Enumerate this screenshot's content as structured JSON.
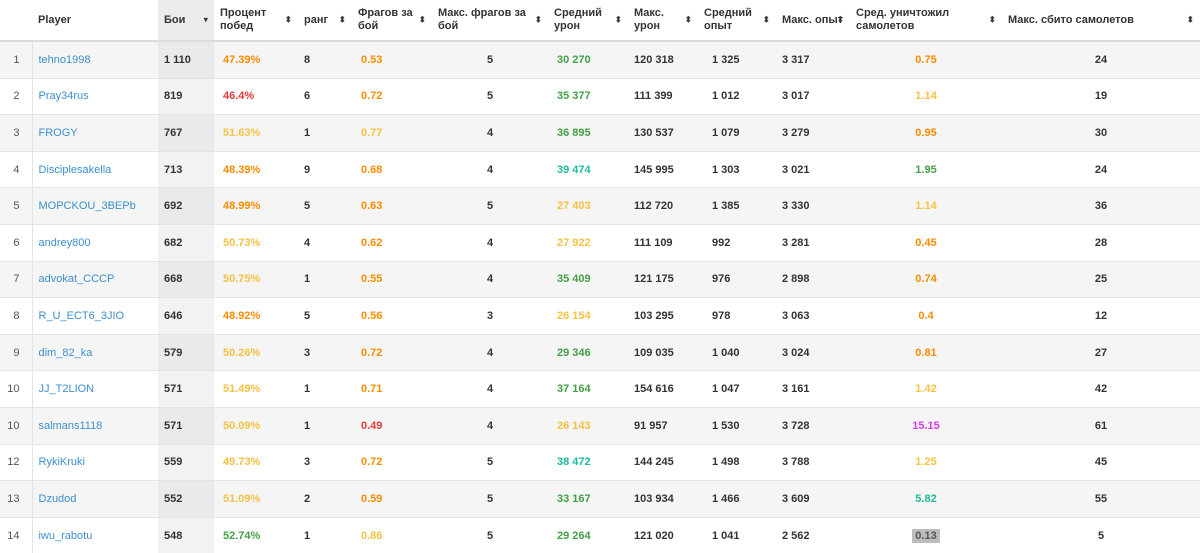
{
  "colors": {
    "orange": "#fb8c00",
    "red": "#e53935",
    "yellow": "#f5c242",
    "green": "#43a047",
    "teal": "#1abc9c",
    "magenta": "#d63df0",
    "dark": "#333333",
    "link": "#3d8fcf"
  },
  "headers": [
    {
      "key": "num",
      "label": "",
      "sort": ""
    },
    {
      "key": "player",
      "label": "Player",
      "sort": ""
    },
    {
      "key": "battles",
      "label": "Бои",
      "sort": "▾"
    },
    {
      "key": "winrate",
      "label": "Процент побед",
      "sort": "⬍"
    },
    {
      "key": "rank",
      "label": "ранг",
      "sort": "⬍"
    },
    {
      "key": "frags",
      "label": "Фрагов за бой",
      "sort": "⬍"
    },
    {
      "key": "maxfrags",
      "label": "Макс. фрагов за бой",
      "sort": "⬍"
    },
    {
      "key": "avgdmg",
      "label": "Средний урон",
      "sort": "⬍"
    },
    {
      "key": "maxdmg",
      "label": "Макс. урон",
      "sort": "⬍"
    },
    {
      "key": "avgxp",
      "label": "Средний опыт",
      "sort": "⬍"
    },
    {
      "key": "maxxp",
      "label": "Макс. опыт",
      "sort": "⬍"
    },
    {
      "key": "avgplanes",
      "label": "Сред. уничтожил самолетов",
      "sort": "⬍"
    },
    {
      "key": "maxplanes",
      "label": "Макс. сбито самолетов",
      "sort": "⬍"
    }
  ],
  "rows": [
    {
      "num": "1",
      "player": "tehno1998",
      "battles": "1 110",
      "winrate": "47.39%",
      "winrate_c": "orange",
      "rank": "8",
      "frags": "0.53",
      "frags_c": "orange",
      "maxfrags": "5",
      "avgdmg": "30 270",
      "avgdmg_c": "green",
      "maxdmg": "120 318",
      "avgxp": "1 325",
      "maxxp": "3 317",
      "avgplanes": "0.75",
      "avgplanes_c": "orange",
      "maxplanes": "24"
    },
    {
      "num": "2",
      "player": "Pray34rus",
      "battles": "819",
      "winrate": "46.4%",
      "winrate_c": "red",
      "rank": "6",
      "frags": "0.72",
      "frags_c": "orange",
      "maxfrags": "5",
      "avgdmg": "35 377",
      "avgdmg_c": "green",
      "maxdmg": "111 399",
      "avgxp": "1 012",
      "maxxp": "3 017",
      "avgplanes": "1.14",
      "avgplanes_c": "yellow",
      "maxplanes": "19"
    },
    {
      "num": "3",
      "player": "FROGY",
      "battles": "767",
      "winrate": "51.63%",
      "winrate_c": "yellow",
      "rank": "1",
      "frags": "0.77",
      "frags_c": "yellow",
      "maxfrags": "4",
      "avgdmg": "36 895",
      "avgdmg_c": "green",
      "maxdmg": "130 537",
      "avgxp": "1 079",
      "maxxp": "3 279",
      "avgplanes": "0.95",
      "avgplanes_c": "orange",
      "maxplanes": "30"
    },
    {
      "num": "4",
      "player": "Disciplesakella",
      "battles": "713",
      "winrate": "48.39%",
      "winrate_c": "orange",
      "rank": "9",
      "frags": "0.68",
      "frags_c": "orange",
      "maxfrags": "4",
      "avgdmg": "39 474",
      "avgdmg_c": "teal",
      "maxdmg": "145 995",
      "avgxp": "1 303",
      "maxxp": "3 021",
      "avgplanes": "1.95",
      "avgplanes_c": "green",
      "maxplanes": "24"
    },
    {
      "num": "5",
      "player": "MOPCKOU_3BEPb",
      "battles": "692",
      "winrate": "48.99%",
      "winrate_c": "orange",
      "rank": "5",
      "frags": "0.63",
      "frags_c": "orange",
      "maxfrags": "5",
      "avgdmg": "27 403",
      "avgdmg_c": "yellow",
      "maxdmg": "112 720",
      "avgxp": "1 385",
      "maxxp": "3 330",
      "avgplanes": "1.14",
      "avgplanes_c": "yellow",
      "maxplanes": "36"
    },
    {
      "num": "6",
      "player": "andrey800",
      "battles": "682",
      "winrate": "50.73%",
      "winrate_c": "yellow",
      "rank": "4",
      "frags": "0.62",
      "frags_c": "orange",
      "maxfrags": "4",
      "avgdmg": "27 922",
      "avgdmg_c": "yellow",
      "maxdmg": "111 109",
      "avgxp": "992",
      "maxxp": "3 281",
      "avgplanes": "0.45",
      "avgplanes_c": "orange",
      "maxplanes": "28"
    },
    {
      "num": "7",
      "player": "advokat_CCCP",
      "battles": "668",
      "winrate": "50.75%",
      "winrate_c": "yellow",
      "rank": "1",
      "frags": "0.55",
      "frags_c": "orange",
      "maxfrags": "4",
      "avgdmg": "35 409",
      "avgdmg_c": "green",
      "maxdmg": "121 175",
      "avgxp": "976",
      "maxxp": "2 898",
      "avgplanes": "0.74",
      "avgplanes_c": "orange",
      "maxplanes": "25"
    },
    {
      "num": "8",
      "player": "R_U_ECT6_3JIO",
      "battles": "646",
      "winrate": "48.92%",
      "winrate_c": "orange",
      "rank": "5",
      "frags": "0.56",
      "frags_c": "orange",
      "maxfrags": "3",
      "avgdmg": "26 154",
      "avgdmg_c": "yellow",
      "maxdmg": "103 295",
      "avgxp": "978",
      "maxxp": "3 063",
      "avgplanes": "0.4",
      "avgplanes_c": "orange",
      "maxplanes": "12"
    },
    {
      "num": "9",
      "player": "dim_82_ka",
      "battles": "579",
      "winrate": "50.26%",
      "winrate_c": "yellow",
      "rank": "3",
      "frags": "0.72",
      "frags_c": "orange",
      "maxfrags": "4",
      "avgdmg": "29 346",
      "avgdmg_c": "green",
      "maxdmg": "109 035",
      "avgxp": "1 040",
      "maxxp": "3 024",
      "avgplanes": "0.81",
      "avgplanes_c": "orange",
      "maxplanes": "27"
    },
    {
      "num": "10",
      "player": "JJ_T2LION",
      "battles": "571",
      "winrate": "51.49%",
      "winrate_c": "yellow",
      "rank": "1",
      "frags": "0.71",
      "frags_c": "orange",
      "maxfrags": "4",
      "avgdmg": "37 164",
      "avgdmg_c": "green",
      "maxdmg": "154 616",
      "avgxp": "1 047",
      "maxxp": "3 161",
      "avgplanes": "1.42",
      "avgplanes_c": "yellow",
      "maxplanes": "42"
    },
    {
      "num": "10",
      "player": "salmans1118",
      "battles": "571",
      "winrate": "50.09%",
      "winrate_c": "yellow",
      "rank": "1",
      "frags": "0.49",
      "frags_c": "red",
      "maxfrags": "4",
      "avgdmg": "26 143",
      "avgdmg_c": "yellow",
      "maxdmg": "91 957",
      "avgxp": "1 530",
      "maxxp": "3 728",
      "avgplanes": "15.15",
      "avgplanes_c": "magenta",
      "maxplanes": "61"
    },
    {
      "num": "12",
      "player": "RykiKruki",
      "battles": "559",
      "winrate": "49.73%",
      "winrate_c": "yellow",
      "rank": "3",
      "frags": "0.72",
      "frags_c": "orange",
      "maxfrags": "5",
      "avgdmg": "38 472",
      "avgdmg_c": "teal",
      "maxdmg": "144 245",
      "avgxp": "1 498",
      "maxxp": "3 788",
      "avgplanes": "1.25",
      "avgplanes_c": "yellow",
      "maxplanes": "45"
    },
    {
      "num": "13",
      "player": "Dzudod",
      "battles": "552",
      "winrate": "51.09%",
      "winrate_c": "yellow",
      "rank": "2",
      "frags": "0.59",
      "frags_c": "orange",
      "maxfrags": "5",
      "avgdmg": "33 167",
      "avgdmg_c": "green",
      "maxdmg": "103 934",
      "avgxp": "1 466",
      "maxxp": "3 609",
      "avgplanes": "5.82",
      "avgplanes_c": "teal",
      "maxplanes": "55"
    },
    {
      "num": "14",
      "player": "iwu_rabotu",
      "battles": "548",
      "winrate": "52.74%",
      "winrate_c": "green",
      "rank": "1",
      "frags": "0.86",
      "frags_c": "yellow",
      "maxfrags": "5",
      "avgdmg": "29 264",
      "avgdmg_c": "green",
      "maxdmg": "121 020",
      "avgxp": "1 041",
      "maxxp": "2 562",
      "avgplanes": "0.13",
      "avgplanes_c": "boxed",
      "maxplanes": "5"
    }
  ]
}
